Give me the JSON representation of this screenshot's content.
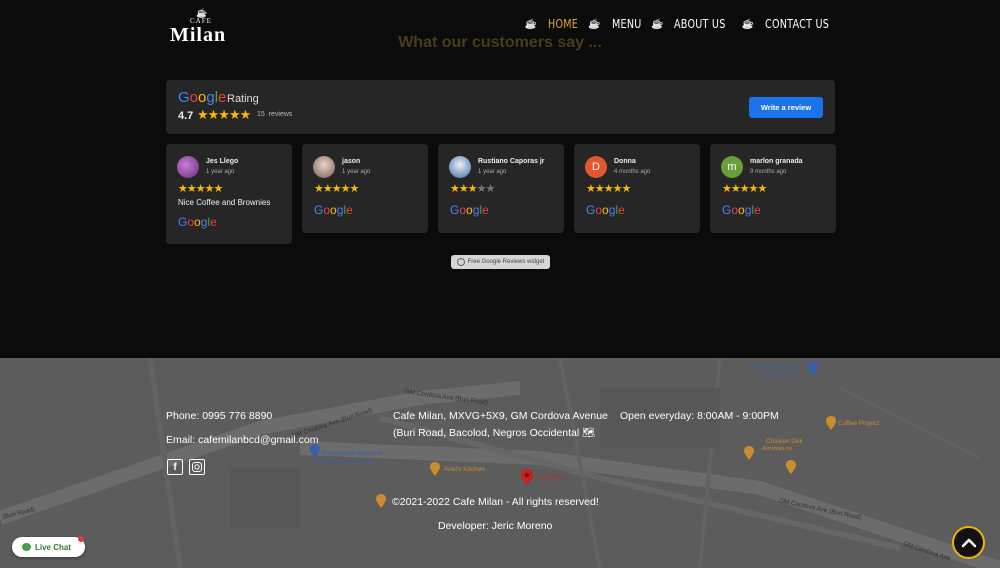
{
  "header": {
    "logo_small": "CAFE",
    "logo_big": "Milan",
    "nav": [
      {
        "label": "HOME",
        "active": true
      },
      {
        "label": "MENU",
        "active": false
      },
      {
        "label": "ABOUT US",
        "active": false
      },
      {
        "label": "CONTACT US",
        "active": false
      }
    ]
  },
  "section_title": "What our customers say ...",
  "rating": {
    "brand": "Google",
    "label": "Rating",
    "score": "4.7",
    "stars": "★★★★★",
    "count": "15",
    "count_suffix": "reviews",
    "write_button": "Write a review"
  },
  "reviews": [
    {
      "name": "Jes Llego",
      "time": "1 year ago",
      "stars": "★★★★★",
      "stars_off": "",
      "text": "Nice Coffee and Brownies",
      "brand": "Google"
    },
    {
      "name": "jason",
      "time": "1 year ago",
      "stars": "★★★★★",
      "stars_off": "",
      "text": "",
      "brand": "Google"
    },
    {
      "name": "Rustiano Caporas jr",
      "time": "1 year ago",
      "stars": "★★★",
      "stars_off": "★★",
      "text": "",
      "brand": "Google"
    },
    {
      "name": "Donna",
      "time": "4 months ago",
      "stars": "★★★★★",
      "stars_off": "",
      "text": "",
      "brand": "Google",
      "initial": "D"
    },
    {
      "name": "marlon granada",
      "time": "9 months ago",
      "stars": "★★★★★",
      "stars_off": "",
      "text": "",
      "brand": "Google",
      "initial": "m"
    }
  ],
  "widget_badge": "Free Google Reviews widget",
  "map_labels": {
    "road1": "GM Cordova Ave (Buri Road)",
    "road2": "GM Cordova Ave (Buri Road)",
    "road3": "GM Cordova Ave (Buri Road)",
    "road4": "GM Cordova Ave",
    "road5": "(Buri Road)",
    "allhome": "AllHome Bacolod",
    "allhome_sub": "Hardware store",
    "coffee_project": "Coffee Project",
    "chicken_deli": "Chicken Deli",
    "chicken_deli_sub": "Alimentas mo",
    "barbecue": "Barbecuean Bacolod",
    "peton": "PETON FLAGS STORE",
    "kitchen": "Ariel's Kitchen",
    "cafe_milan_pin": "Cafe Milan"
  },
  "footer": {
    "phone": "Phone: 0995 776 8890",
    "email": "Email: cafemilanbcd@gmail.com",
    "address_line1": "Cafe Milan, MXVG+5X9, GM Cordova Avenue",
    "address_line2": "(Buri Road, Bacolod, Negros Occidental 🗺",
    "hours": "Open everyday: 8:00AM - 9:00PM",
    "copyright": "©2021-2022 Cafe Milan - All rights reserved!",
    "developer": "Developer: Jeric Moreno"
  },
  "live_chat": "Live Chat",
  "colors": {
    "accent": "#e0a43a",
    "star": "#f6bb06",
    "button": "#1a73e8",
    "to_top_ring": "#f2b400"
  }
}
